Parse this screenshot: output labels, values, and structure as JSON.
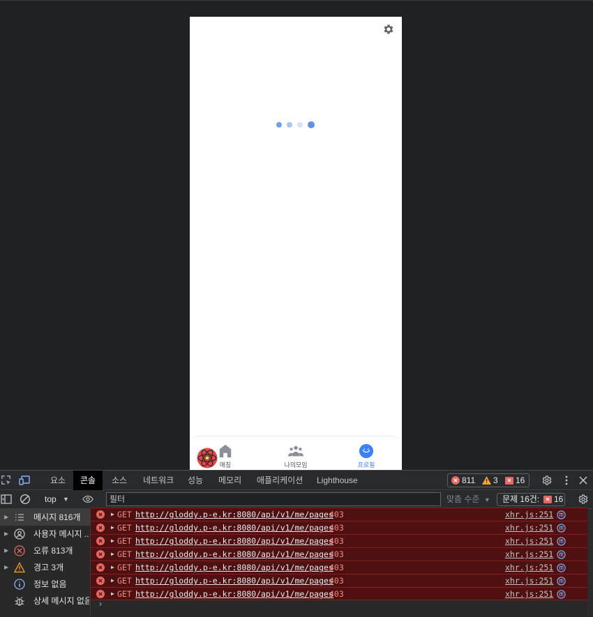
{
  "page": {
    "bottom_tabs": [
      {
        "label": "매칭",
        "icon": "home-icon"
      },
      {
        "label": "나의모임",
        "icon": "group-icon"
      },
      {
        "label": "프로필",
        "icon": "profile-smile-icon",
        "active": true
      }
    ]
  },
  "devtools": {
    "tabs": [
      "요소",
      "콘솔",
      "소스",
      "네트워크",
      "성능",
      "메모리",
      "애플리케이션",
      "Lighthouse"
    ],
    "active_tab": "콘솔",
    "counts": {
      "errors": "811",
      "warnings": "3",
      "issues": "16"
    },
    "toolbar": {
      "context": "top",
      "filter_placeholder": "필터",
      "levels": "맞춤 수준",
      "issues_label": "문제 16건:",
      "issues_count": "16"
    },
    "sidebar": [
      {
        "label": "메시지 816개",
        "icon": "list-icon"
      },
      {
        "label": "사용자 메시지 ...",
        "icon": "user-icon"
      },
      {
        "label": "오류 813개",
        "icon": "error-icon"
      },
      {
        "label": "경고 3개",
        "icon": "warning-icon"
      },
      {
        "label": "정보 없음",
        "icon": "info-icon"
      },
      {
        "label": "상세 메시지 없음",
        "icon": "bug-icon"
      }
    ],
    "log_rows": [
      {
        "method": "GET",
        "url": "http://gloddy.p-e.kr:8080/api/v1/me/pages",
        "status": "403",
        "source": "xhr.js:251"
      },
      {
        "method": "GET",
        "url": "http://gloddy.p-e.kr:8080/api/v1/me/pages",
        "status": "403",
        "source": "xhr.js:251"
      },
      {
        "method": "GET",
        "url": "http://gloddy.p-e.kr:8080/api/v1/me/pages",
        "status": "403",
        "source": "xhr.js:251"
      },
      {
        "method": "GET",
        "url": "http://gloddy.p-e.kr:8080/api/v1/me/pages",
        "status": "403",
        "source": "xhr.js:251"
      },
      {
        "method": "GET",
        "url": "http://gloddy.p-e.kr:8080/api/v1/me/pages",
        "status": "403",
        "source": "xhr.js:251"
      },
      {
        "method": "GET",
        "url": "http://gloddy.p-e.kr:8080/api/v1/me/pages",
        "status": "403",
        "source": "xhr.js:251"
      },
      {
        "method": "GET",
        "url": "http://gloddy.p-e.kr:8080/api/v1/me/pages",
        "status": "403",
        "source": "xhr.js:251"
      }
    ],
    "prompt": "›"
  },
  "colors": {
    "accent": "#3b82f6",
    "error_bg": "#4e1010",
    "error_text": "#f28b82"
  }
}
